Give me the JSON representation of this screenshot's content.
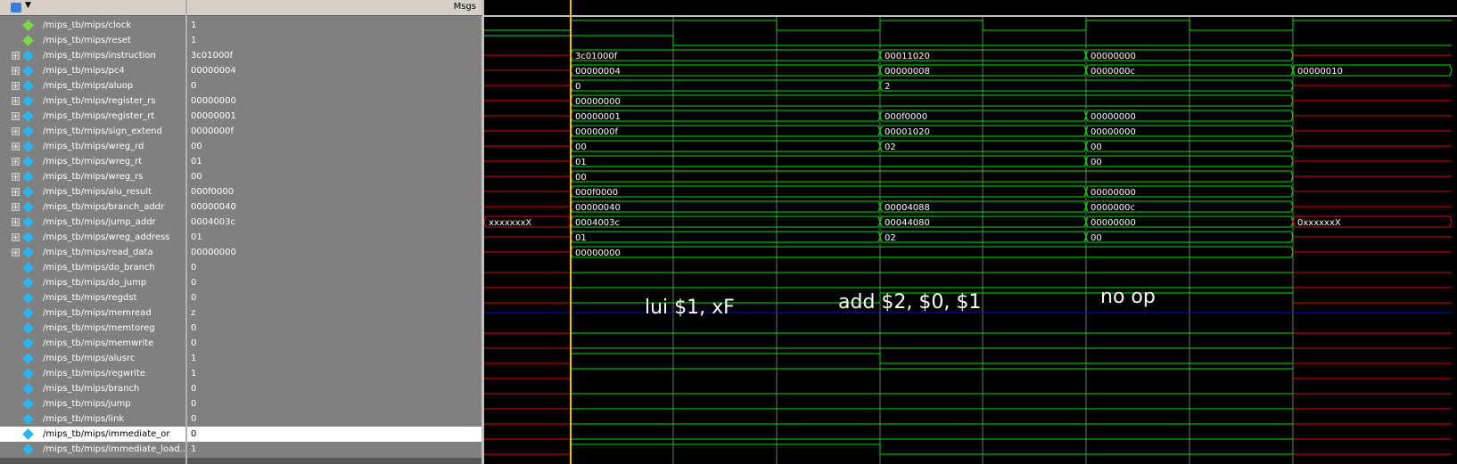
{
  "header": {
    "msgs_label": "Msgs"
  },
  "icons": {
    "header_icon": "wave-window-icon",
    "signal_icon": "signal-diamond-icon",
    "input_icon": "input-signal-icon",
    "expander": "plus-box-icon"
  },
  "colors": {
    "wave_green": "#00e000",
    "wave_red": "#e00000",
    "cursor": "#f0c000",
    "blue_line": "#0000ff",
    "grid": "#9fdcad"
  },
  "signals": [
    {
      "name": "/mips_tb/mips/clock",
      "value": "1",
      "expandable": false,
      "input": true
    },
    {
      "name": "/mips_tb/mips/reset",
      "value": "1",
      "expandable": false,
      "input": true
    },
    {
      "name": "/mips_tb/mips/instruction",
      "value": "3c01000f",
      "expandable": true,
      "input": false
    },
    {
      "name": "/mips_tb/mips/pc4",
      "value": "00000004",
      "expandable": true,
      "input": false
    },
    {
      "name": "/mips_tb/mips/aluop",
      "value": "0",
      "expandable": true,
      "input": false
    },
    {
      "name": "/mips_tb/mips/register_rs",
      "value": "00000000",
      "expandable": true,
      "input": false
    },
    {
      "name": "/mips_tb/mips/register_rt",
      "value": "00000001",
      "expandable": true,
      "input": false
    },
    {
      "name": "/mips_tb/mips/sign_extend",
      "value": "0000000f",
      "expandable": true,
      "input": false
    },
    {
      "name": "/mips_tb/mips/wreg_rd",
      "value": "00",
      "expandable": true,
      "input": false
    },
    {
      "name": "/mips_tb/mips/wreg_rt",
      "value": "01",
      "expandable": true,
      "input": false
    },
    {
      "name": "/mips_tb/mips/wreg_rs",
      "value": "00",
      "expandable": true,
      "input": false
    },
    {
      "name": "/mips_tb/mips/alu_result",
      "value": "000f0000",
      "expandable": true,
      "input": false
    },
    {
      "name": "/mips_tb/mips/branch_addr",
      "value": "00000040",
      "expandable": true,
      "input": false
    },
    {
      "name": "/mips_tb/mips/jump_addr",
      "value": "0004003c",
      "expandable": true,
      "input": false
    },
    {
      "name": "/mips_tb/mips/wreg_address",
      "value": "01",
      "expandable": true,
      "input": false
    },
    {
      "name": "/mips_tb/mips/read_data",
      "value": "00000000",
      "expandable": true,
      "input": false
    },
    {
      "name": "/mips_tb/mips/do_branch",
      "value": "0",
      "expandable": false,
      "input": false
    },
    {
      "name": "/mips_tb/mips/do_jump",
      "value": "0",
      "expandable": false,
      "input": false
    },
    {
      "name": "/mips_tb/mips/regdst",
      "value": "0",
      "expandable": false,
      "input": false
    },
    {
      "name": "/mips_tb/mips/memread",
      "value": "z",
      "expandable": false,
      "input": false
    },
    {
      "name": "/mips_tb/mips/memtoreg",
      "value": "0",
      "expandable": false,
      "input": false
    },
    {
      "name": "/mips_tb/mips/memwrite",
      "value": "0",
      "expandable": false,
      "input": false
    },
    {
      "name": "/mips_tb/mips/alusrc",
      "value": "1",
      "expandable": false,
      "input": false
    },
    {
      "name": "/mips_tb/mips/regwrite",
      "value": "1",
      "expandable": false,
      "input": false
    },
    {
      "name": "/mips_tb/mips/branch",
      "value": "0",
      "expandable": false,
      "input": false
    },
    {
      "name": "/mips_tb/mips/jump",
      "value": "0",
      "expandable": false,
      "input": false
    },
    {
      "name": "/mips_tb/mips/link",
      "value": "0",
      "expandable": false,
      "input": false
    },
    {
      "name": "/mips_tb/mips/immediate_or",
      "value": "0",
      "expandable": false,
      "input": false,
      "selected": true
    },
    {
      "name": "/mips_tb/mips/immediate_load...",
      "value": "1",
      "expandable": false,
      "input": false
    }
  ],
  "annotations": [
    {
      "text": "lui $1, xF"
    },
    {
      "text": "add $2, $0, $1"
    },
    {
      "text": "no op"
    }
  ],
  "waves": {
    "instruction": [
      "3c01000f",
      "00011020",
      "00000000"
    ],
    "pc4": [
      "00000004",
      "00000008",
      "0000000c",
      "00000010"
    ],
    "aluop": [
      "0",
      "2"
    ],
    "register_rs": [
      "00000000"
    ],
    "register_rt": [
      "00000001",
      "000f0000",
      "00000000"
    ],
    "sign_extend": [
      "0000000f",
      "00001020",
      "00000000"
    ],
    "wreg_rd": [
      "00",
      "02",
      "00"
    ],
    "wreg_rt": [
      "01",
      "00"
    ],
    "wreg_rs": [
      "00"
    ],
    "alu_result": [
      "000f0000",
      "00000000"
    ],
    "branch_addr": [
      "00000040",
      "00004088",
      "0000000c"
    ],
    "jump_addr": [
      "xxxxxxxX",
      "0004003c",
      "00044080",
      "00000000",
      "0xxxxxxX"
    ],
    "wreg_address": [
      "01",
      "02",
      "00"
    ],
    "read_data": [
      "00000000"
    ]
  }
}
